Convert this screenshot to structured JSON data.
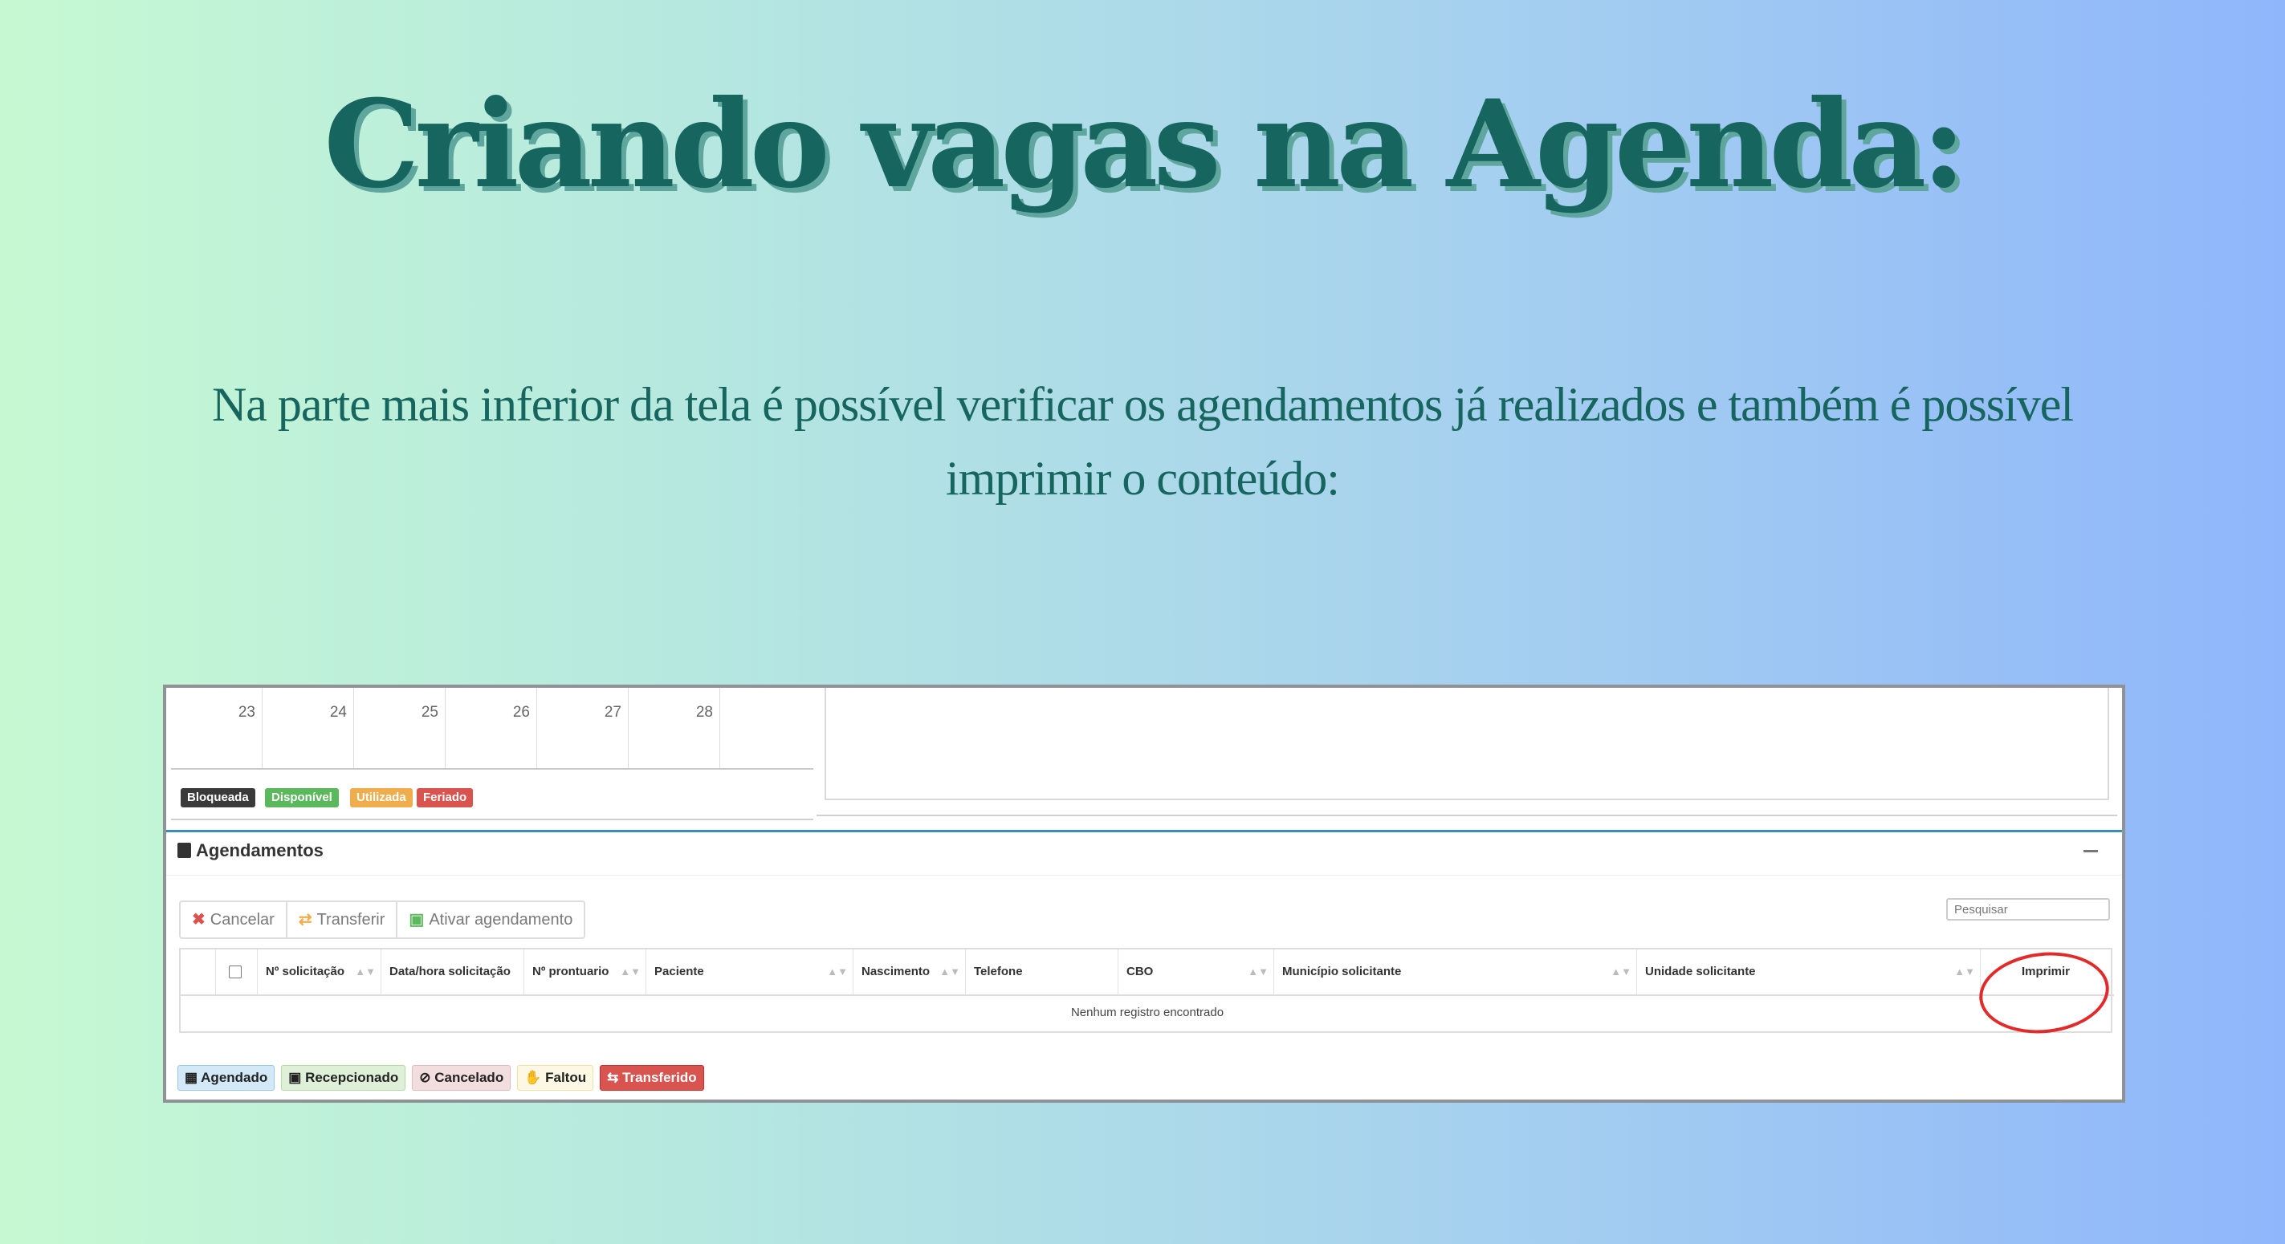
{
  "slide": {
    "title": "Criando vagas na Agenda:",
    "subtitle": "Na parte mais inferior da tela é possível verificar os agendamentos já realizados e também é possível imprimir o conteúdo:"
  },
  "calendar": {
    "days": [
      "23",
      "24",
      "25",
      "26",
      "27",
      "28",
      ""
    ]
  },
  "calendar_legend": [
    {
      "label": "Bloqueada",
      "color": "#3a3a3a"
    },
    {
      "label": "Disponível",
      "color": "#5cb85c"
    },
    {
      "label": "Utilizada",
      "color": "#f0ad4e"
    },
    {
      "label": "Feriado",
      "color": "#d9534f"
    }
  ],
  "agendamentos": {
    "title": "Agendamentos",
    "buttons": {
      "cancel": "Cancelar",
      "transfer": "Transferir",
      "activate": "Ativar agendamento"
    },
    "search_placeholder": "Pesquisar",
    "columns": [
      "Nº solicitação",
      "Data/hora solicitação",
      "Nº prontuario",
      "Paciente",
      "Nascimento",
      "Telefone",
      "CBO",
      "Município solicitante",
      "Unidade solicitante",
      "Imprimir"
    ],
    "empty_text": "Nenhum registro encontrado"
  },
  "status_legend": [
    {
      "label": "Agendado",
      "bg": "#d3e9f7",
      "fg": "#222",
      "icon": "calendar-icon"
    },
    {
      "label": "Recepcionado",
      "bg": "#dff0d8",
      "fg": "#222",
      "icon": "calendar-check-icon"
    },
    {
      "label": "Cancelado",
      "bg": "#f2dede",
      "fg": "#222",
      "icon": "ban-icon"
    },
    {
      "label": "Faltou",
      "bg": "#fcf8e3",
      "fg": "#222",
      "icon": "thumbs-down-icon"
    },
    {
      "label": "Transferido",
      "bg": "#d9534f",
      "fg": "#ffffff",
      "icon": "retweet-icon"
    }
  ],
  "colors": {
    "title": "#17655f",
    "highlight_circle": "#e22a2a",
    "accent_line": "#3c8dbc"
  }
}
